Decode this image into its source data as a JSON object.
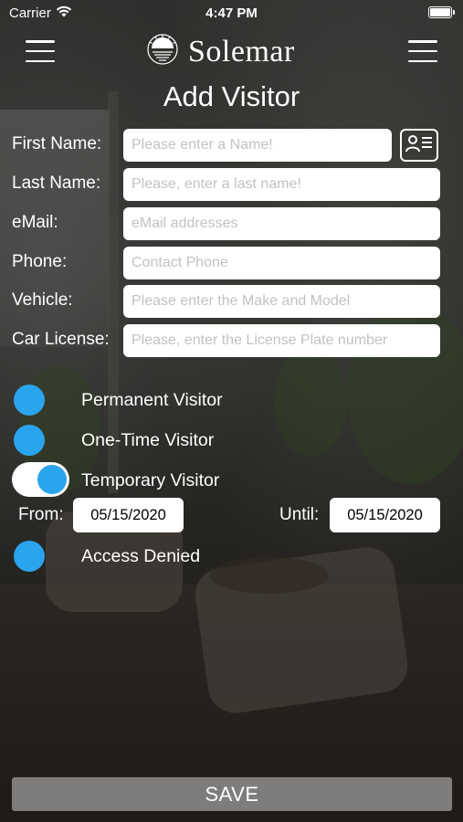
{
  "status_bar": {
    "carrier": "Carrier",
    "time": "4:47 PM",
    "wifi_icon": "wifi-icon",
    "battery_icon": "battery-icon"
  },
  "header": {
    "brand": "Solemar",
    "logo_icon": "sun-over-water-icon",
    "title": "Add Visitor"
  },
  "form": {
    "first_name": {
      "label": "First Name:",
      "placeholder": "Please enter a Name!"
    },
    "last_name": {
      "label": "Last Name:",
      "placeholder": "Please, enter a last name!"
    },
    "email": {
      "label": "eMail:",
      "placeholder": "eMail addresses"
    },
    "phone": {
      "label": "Phone:",
      "placeholder": "Contact Phone"
    },
    "vehicle": {
      "label": "Vehicle:",
      "placeholder": "Please enter the Make and Model"
    },
    "car_license": {
      "label": "Car License:",
      "placeholder": "Please, enter the License Plate number"
    },
    "contact_picker_icon": "contact-card-icon"
  },
  "visitor_types": {
    "permanent": {
      "label": "Permanent Visitor",
      "on": false
    },
    "one_time": {
      "label": "One-Time Visitor",
      "on": false
    },
    "temporary": {
      "label": "Temporary Visitor",
      "on": true
    },
    "access_denied": {
      "label": "Access Denied",
      "on": false
    }
  },
  "dates": {
    "from_label": "From:",
    "from_value": "05/15/2020",
    "until_label": "Until:",
    "until_value": "05/15/2020"
  },
  "save_label": "SAVE",
  "colors": {
    "accent": "#2aa4ec",
    "save_button": "#7f7d7b",
    "placeholder": "#c2c2c2"
  }
}
